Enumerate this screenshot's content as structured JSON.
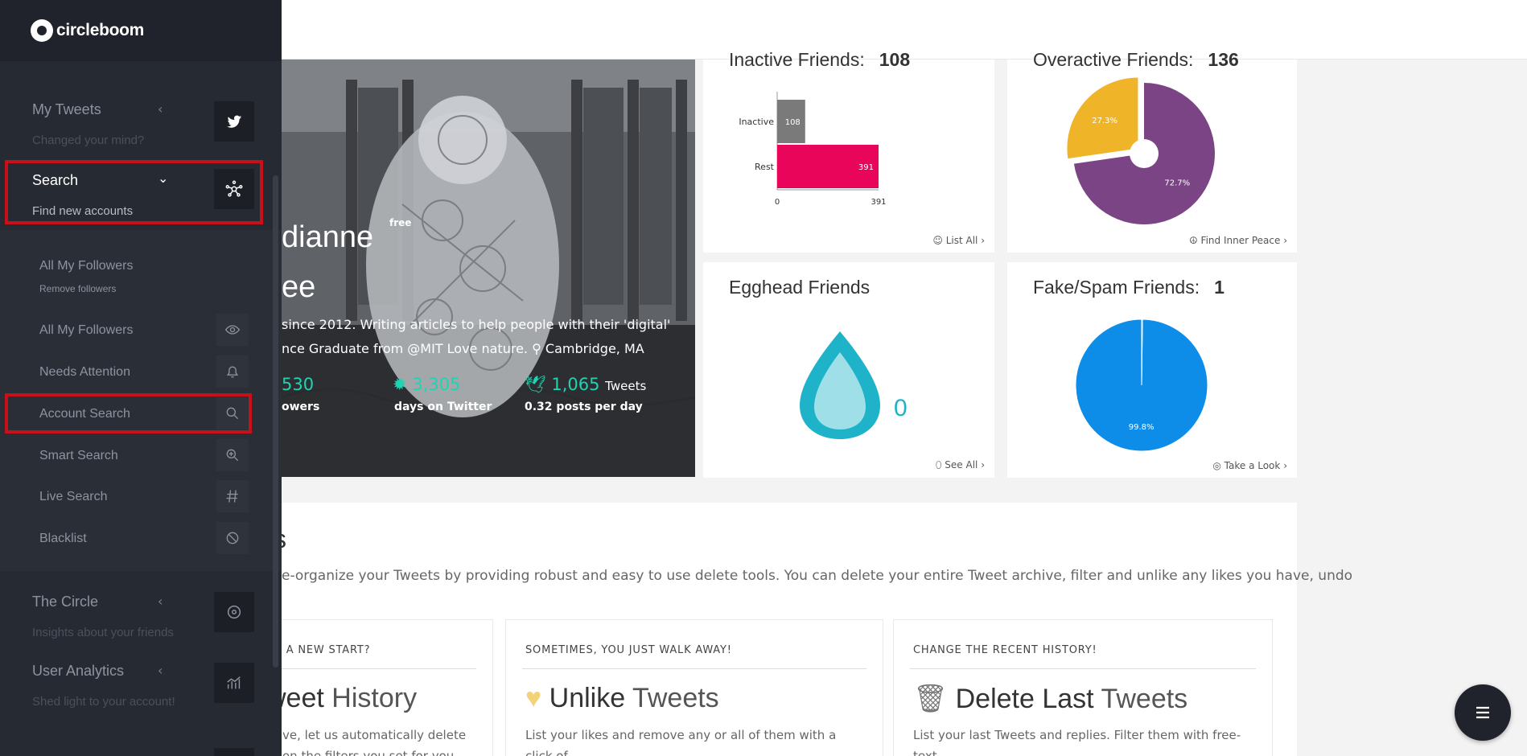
{
  "brand": {
    "name": "circleboom"
  },
  "sidebar": {
    "sections": [
      {
        "title": "My Tweets",
        "subtitle": "Changed your mind?",
        "icon": "twitter-icon"
      },
      {
        "title": "Search",
        "subtitle": "Find new accounts",
        "icon": "network-icon"
      },
      {
        "title": "The Circle",
        "subtitle": "Insights about your friends",
        "icon": "circle-target-icon"
      },
      {
        "title": "User Analytics",
        "subtitle": "Shed light to your account!",
        "icon": "analytics-icon"
      }
    ],
    "search_items": [
      {
        "label": "All My Followers",
        "sublabel": "Remove followers"
      },
      {
        "label": "All My Followers",
        "icon": "eye-icon"
      },
      {
        "label": "Needs Attention",
        "icon": "bell-icon"
      },
      {
        "label": "Account Search",
        "icon": "search-icon"
      },
      {
        "label": "Smart Search",
        "icon": "zoom-in-icon"
      },
      {
        "label": "Live Search",
        "icon": "hashtag-icon"
      },
      {
        "label": "Blacklist",
        "icon": "ban-icon"
      }
    ]
  },
  "profile": {
    "name_line1": "dianne",
    "name_line2": "ee",
    "badge": "free",
    "bio_line1": "since 2012. Writing articles to help people with their 'digital'",
    "bio_line2": "nce Graduate from @MIT Love nature.",
    "location": "Cambridge, MA",
    "followers_num": "530",
    "followers_label": "owers",
    "days_num": "3,305",
    "days_label": "days on Twitter",
    "tweets_num": "1,065",
    "tweets_unit": "Tweets",
    "tweets_label": "0.32 posts per day"
  },
  "cards": {
    "inactive": {
      "title": "Inactive Friends:",
      "count": "108",
      "link": "List All"
    },
    "overactive": {
      "title": "Overactive Friends:",
      "count": "136",
      "link": "Find Inner Peace"
    },
    "egghead": {
      "title": "Egghead Friends",
      "count": "0",
      "link": "See All"
    },
    "fake": {
      "title": "Fake/Spam Friends:",
      "count": "1",
      "link": "Take a Look"
    }
  },
  "chart_data": [
    {
      "type": "bar",
      "orientation": "horizontal",
      "categories": [
        "Inactive",
        "Rest"
      ],
      "values": [
        108,
        391
      ],
      "data_labels": [
        "108",
        "391"
      ],
      "colors": [
        "#7a7a7a",
        "#e8055a"
      ],
      "xlim": [
        0,
        391
      ],
      "x_ticks": [
        "0",
        "391"
      ]
    },
    {
      "type": "pie",
      "labels": [
        "27.3%",
        "72.7%"
      ],
      "values": [
        27.3,
        72.7
      ],
      "colors": [
        "#f0b429",
        "#7b4585"
      ]
    },
    {
      "type": "pie",
      "labels": [
        "99.8%"
      ],
      "values": [
        99.8,
        0.2
      ],
      "colors": [
        "#0d8de8",
        "#ffffff"
      ]
    }
  ],
  "delete_section": {
    "heading": "s",
    "description": "e-organize your Tweets by providing robust and easy to use delete tools. You can delete your entire Tweet archive, filter and unlike any likes you have, undo",
    "tools": [
      {
        "kicker": "R A NEW START?",
        "title_bold": "weet",
        "title_light": "History",
        "text": "ve, let us automatically delete\non the filters you set for you"
      },
      {
        "kicker": "SOMETIMES, YOU JUST WALK AWAY!",
        "title_bold": "Unlike",
        "title_light": "Tweets",
        "icon": "broken-heart-icon",
        "text": "List your likes and remove any or all of them with a click of\na button! Filter your likes with free-text search to pin"
      },
      {
        "kicker": "CHANGE THE RECENT HISTORY!",
        "title_bold": "Delete Last",
        "title_light": "Tweets",
        "icon": "trash-icon",
        "text": "List your last Tweets and replies. Filter them with free-text\nsearch and delete any (or all) of them with a few clicks"
      }
    ]
  },
  "fab": {
    "icon": "menu-icon"
  }
}
